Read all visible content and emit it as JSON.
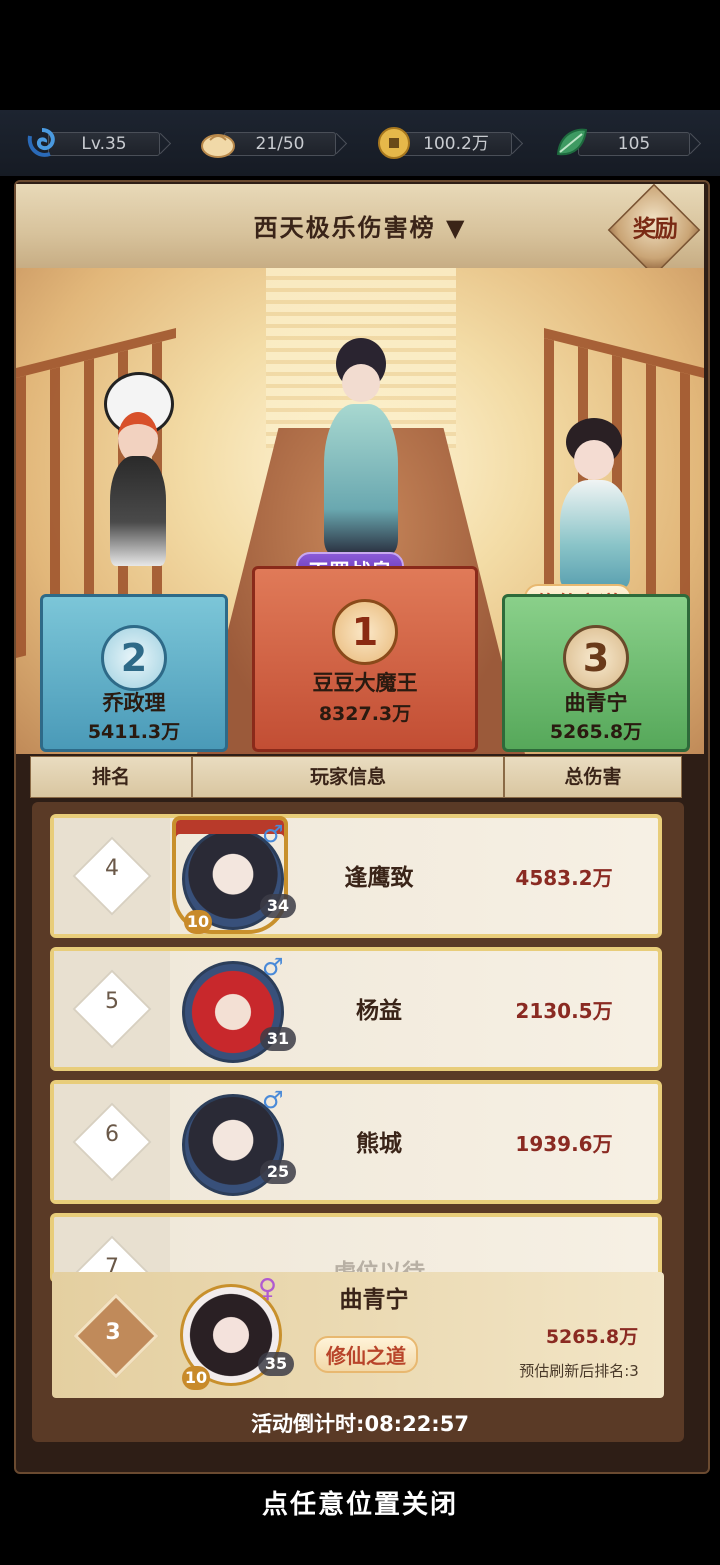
{
  "resources": {
    "level": "Lv.35",
    "stamina": "21/50",
    "coins": "100.2万",
    "jade": "105"
  },
  "header": {
    "title": "西天极乐伤害榜 ▼",
    "reward_label": "奖励"
  },
  "podium": {
    "first": {
      "rank": "1",
      "name": "豆豆大魔王",
      "damage": "8327.3万",
      "title": "天罡战皇"
    },
    "second": {
      "rank": "2",
      "name": "乔政理",
      "damage": "5411.3万"
    },
    "third": {
      "rank": "3",
      "name": "曲青宁",
      "damage": "5265.8万",
      "title": "修仙之道"
    }
  },
  "table": {
    "headers": [
      "排名",
      "玩家信息",
      "总伤害"
    ]
  },
  "rows": [
    {
      "rank": "4",
      "name": "逢鹰致",
      "damage": "4583.2万",
      "level": "34",
      "vip": "10",
      "gender": "♂"
    },
    {
      "rank": "5",
      "name": "杨益",
      "damage": "2130.5万",
      "level": "31",
      "gender": "♂"
    },
    {
      "rank": "6",
      "name": "熊城",
      "damage": "1939.6万",
      "level": "25",
      "gender": "♂"
    }
  ],
  "partial_row": {
    "rank": "7",
    "name": "虚位以待"
  },
  "me": {
    "rank": "3",
    "name": "曲青宁",
    "title": "修仙之道",
    "damage": "5265.8万",
    "level": "35",
    "vip": "10",
    "gender": "♀",
    "estimate": "预估刷新后排名:3"
  },
  "countdown": "活动倒计时:08:22:57",
  "close_hint": "点任意位置关闭",
  "colors": {
    "gold": "#e8cd7a",
    "damage_red": "#8a2a22",
    "male_blue": "#4a8ad8",
    "female_purple": "#b05ad0"
  }
}
